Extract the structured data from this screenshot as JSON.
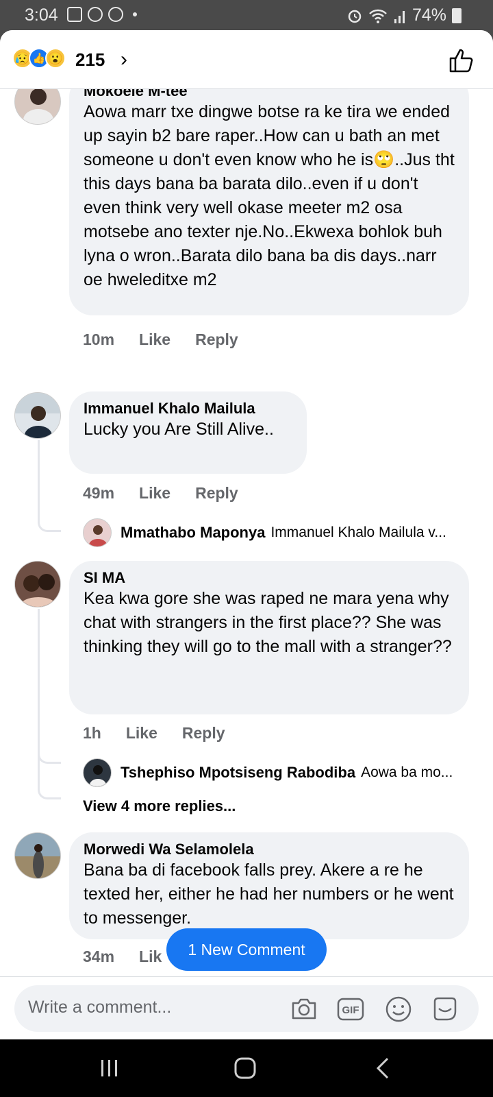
{
  "status_bar": {
    "time": "3:04",
    "battery": "74%"
  },
  "header": {
    "reaction_count": "215",
    "reactions": [
      "sad-reaction-icon",
      "like-reaction-icon",
      "wow-reaction-icon"
    ]
  },
  "comments": [
    {
      "author": "Mokoele M-tee",
      "text": "Aowa marr txe dingwe botse ra ke tira we ended up sayin b2 bare raper..How can u bath an met someone u don't even know who he is🙄..Jus tht this days bana ba barata dilo..even if u don't even think very well okase meeter m2 osa motsebe ano texter nje.No..Ekwexa bohlok buh lyna o wron..Barata dilo bana ba dis days..narr oe hweleditxe m2",
      "time": "10m",
      "like": "Like",
      "reply": "Reply"
    },
    {
      "author": "Immanuel Khalo Mailula",
      "text": "Lucky you Are Still Alive..",
      "time": "49m",
      "like": "Like",
      "reply": "Reply",
      "reply_preview": {
        "author": "Mmathabo Maponya",
        "snippet": "Immanuel Khalo Mailula v..."
      }
    },
    {
      "author": "SI MA",
      "text": "Kea kwa gore she was raped ne mara yena why chat with strangers in the first place?? She was thinking they will go to the mall with a stranger??",
      "time": "1h",
      "like": "Like",
      "reply": "Reply",
      "reply_preview": {
        "author": "Tshephiso Mpotsiseng Rabodiba",
        "snippet": "Aowa ba mo..."
      },
      "view_more": "View 4 more replies..."
    },
    {
      "author": "Morwedi Wa Selamolela",
      "text": "Bana ba di facebook falls prey. Akere a re he texted her, either he had her numbers or he went to messenger.",
      "time": "34m",
      "like": "Lik"
    }
  ],
  "new_comment_pill": "1 New Comment",
  "composer": {
    "placeholder": "Write a comment..."
  },
  "colors": {
    "accent": "#1877f2",
    "bubble": "#f0f2f5",
    "meta": "#65676b"
  }
}
